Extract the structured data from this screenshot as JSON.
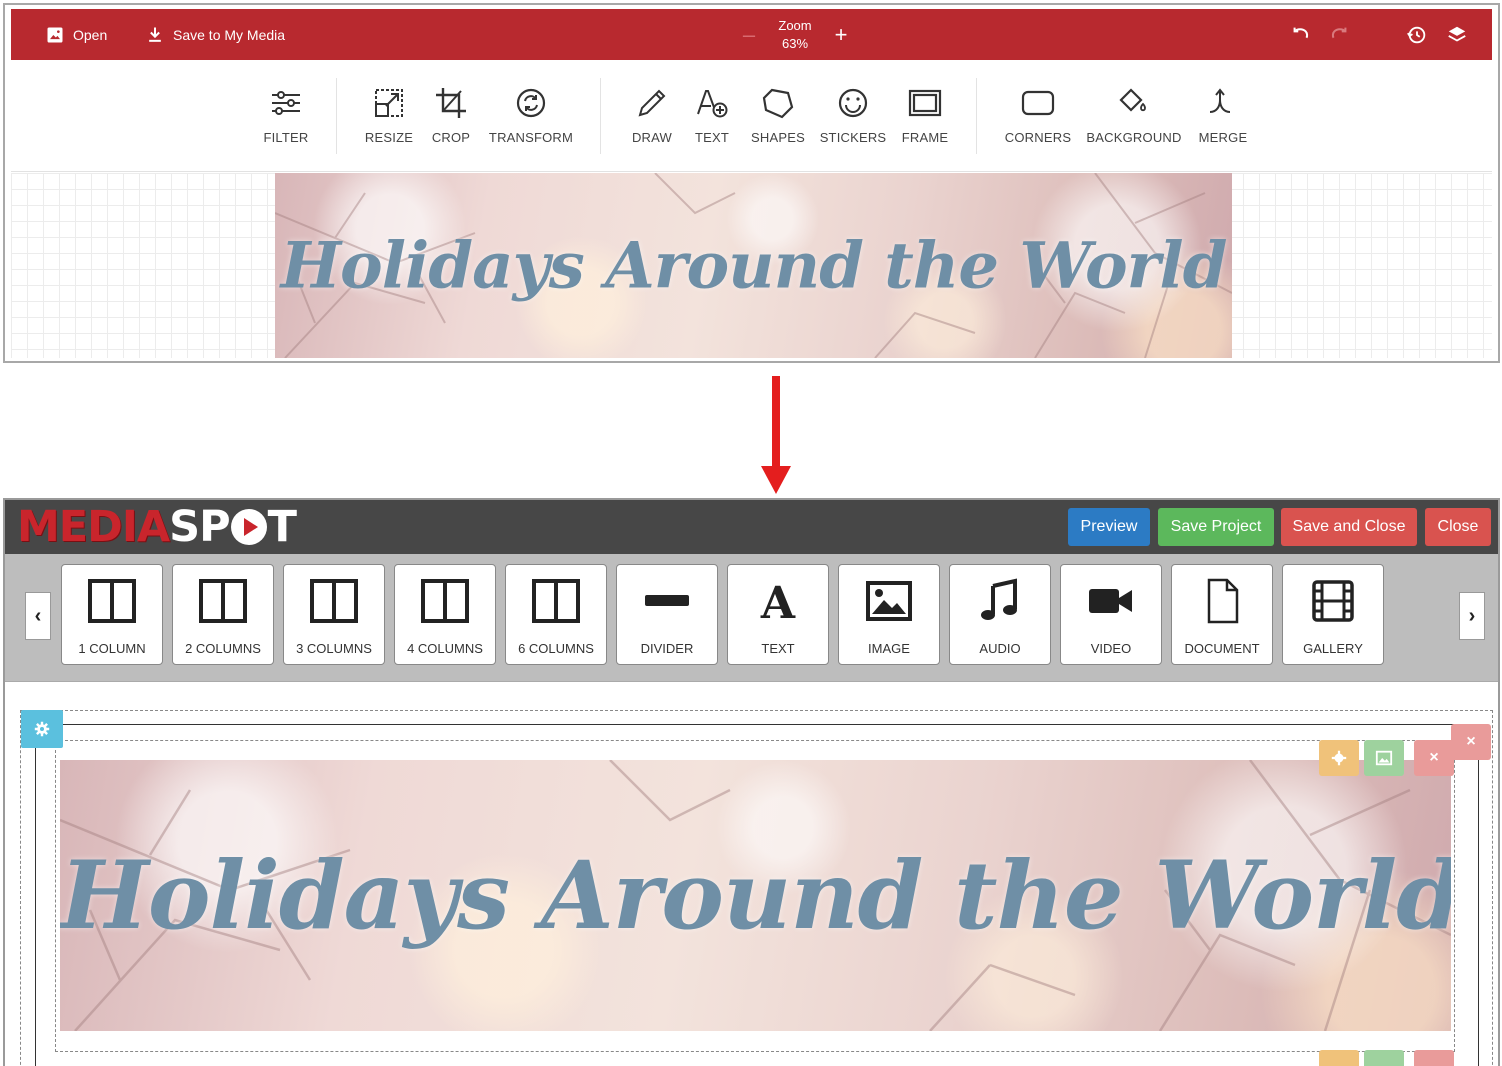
{
  "editor": {
    "open_label": "Open",
    "save_label": "Save to My Media",
    "zoom_label": "Zoom",
    "zoom_value": "63%",
    "tools": [
      {
        "id": "filter",
        "label": "FILTER"
      },
      {
        "id": "resize",
        "label": "RESIZE"
      },
      {
        "id": "crop",
        "label": "CROP"
      },
      {
        "id": "transform",
        "label": "TRANSFORM"
      },
      {
        "id": "draw",
        "label": "DRAW"
      },
      {
        "id": "text",
        "label": "TEXT"
      },
      {
        "id": "shapes",
        "label": "SHAPES"
      },
      {
        "id": "stickers",
        "label": "STICKERS"
      },
      {
        "id": "frame",
        "label": "FRAME"
      },
      {
        "id": "corners",
        "label": "CORNERS"
      },
      {
        "id": "background",
        "label": "BACKGROUND"
      },
      {
        "id": "merge",
        "label": "MERGE"
      }
    ],
    "bar_color": "#b8292f"
  },
  "banner": {
    "title": "Holidays Around the World"
  },
  "mediaspot": {
    "logo_part1": "MEDIA",
    "logo_part2": "SP",
    "logo_part3": "T",
    "buttons": {
      "preview": "Preview",
      "save_project": "Save Project",
      "save_and_close": "Save and Close",
      "close": "Close"
    },
    "prev_arrow": "‹",
    "next_arrow": "›",
    "blocks": [
      {
        "id": "1col",
        "label": "1 COLUMN"
      },
      {
        "id": "2col",
        "label": "2 COLUMNS"
      },
      {
        "id": "3col",
        "label": "3 COLUMNS"
      },
      {
        "id": "4col",
        "label": "4 COLUMNS"
      },
      {
        "id": "6col",
        "label": "6 COLUMNS"
      },
      {
        "id": "divider",
        "label": "DIVIDER"
      },
      {
        "id": "text",
        "label": "TEXT"
      },
      {
        "id": "image",
        "label": "IMAGE"
      },
      {
        "id": "audio",
        "label": "AUDIO"
      },
      {
        "id": "video",
        "label": "VIDEO"
      },
      {
        "id": "document",
        "label": "DOCUMENT"
      },
      {
        "id": "gallery",
        "label": "GALLERY"
      }
    ],
    "colors": {
      "header": "#474747",
      "preview": "#2c7bc4",
      "save_project": "#5cb85c",
      "danger": "#d9534f",
      "settings": "#5bc0de"
    }
  }
}
